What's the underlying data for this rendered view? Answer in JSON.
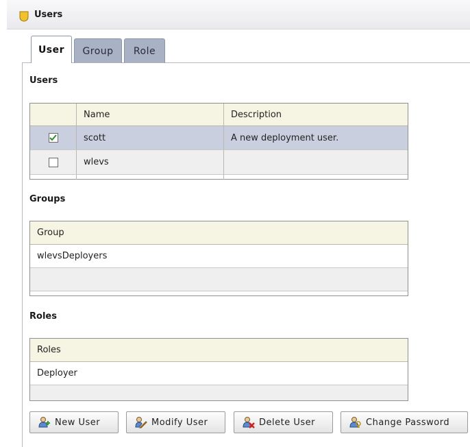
{
  "header": {
    "title": "Users",
    "icon": "shield-icon"
  },
  "tabs": [
    {
      "label": "User",
      "active": true
    },
    {
      "label": "Group",
      "active": false
    },
    {
      "label": "Role",
      "active": false
    }
  ],
  "users_section": {
    "title": "Users",
    "columns": [
      "",
      "Name",
      "Description"
    ],
    "rows": [
      {
        "checked": true,
        "name": "scott",
        "description": "A new deployment user.",
        "selected": true
      },
      {
        "checked": false,
        "name": "wlevs",
        "description": "",
        "selected": false
      }
    ]
  },
  "groups_section": {
    "title": "Groups",
    "column": "Group",
    "rows": [
      "wlevsDeployers",
      ""
    ]
  },
  "roles_section": {
    "title": "Roles",
    "column": "Roles",
    "rows": [
      "Deployer",
      ""
    ]
  },
  "toolbar": {
    "new_user": "New User",
    "modify_user": "Modify User",
    "delete_user": "Delete User",
    "change_password": "Change Password"
  },
  "colors": {
    "header_bg": "#f6f4e2",
    "selected_row": "#c9cfdf",
    "inactive_tab": "#a9b1c4",
    "checkmark": "#2e8b2e"
  }
}
